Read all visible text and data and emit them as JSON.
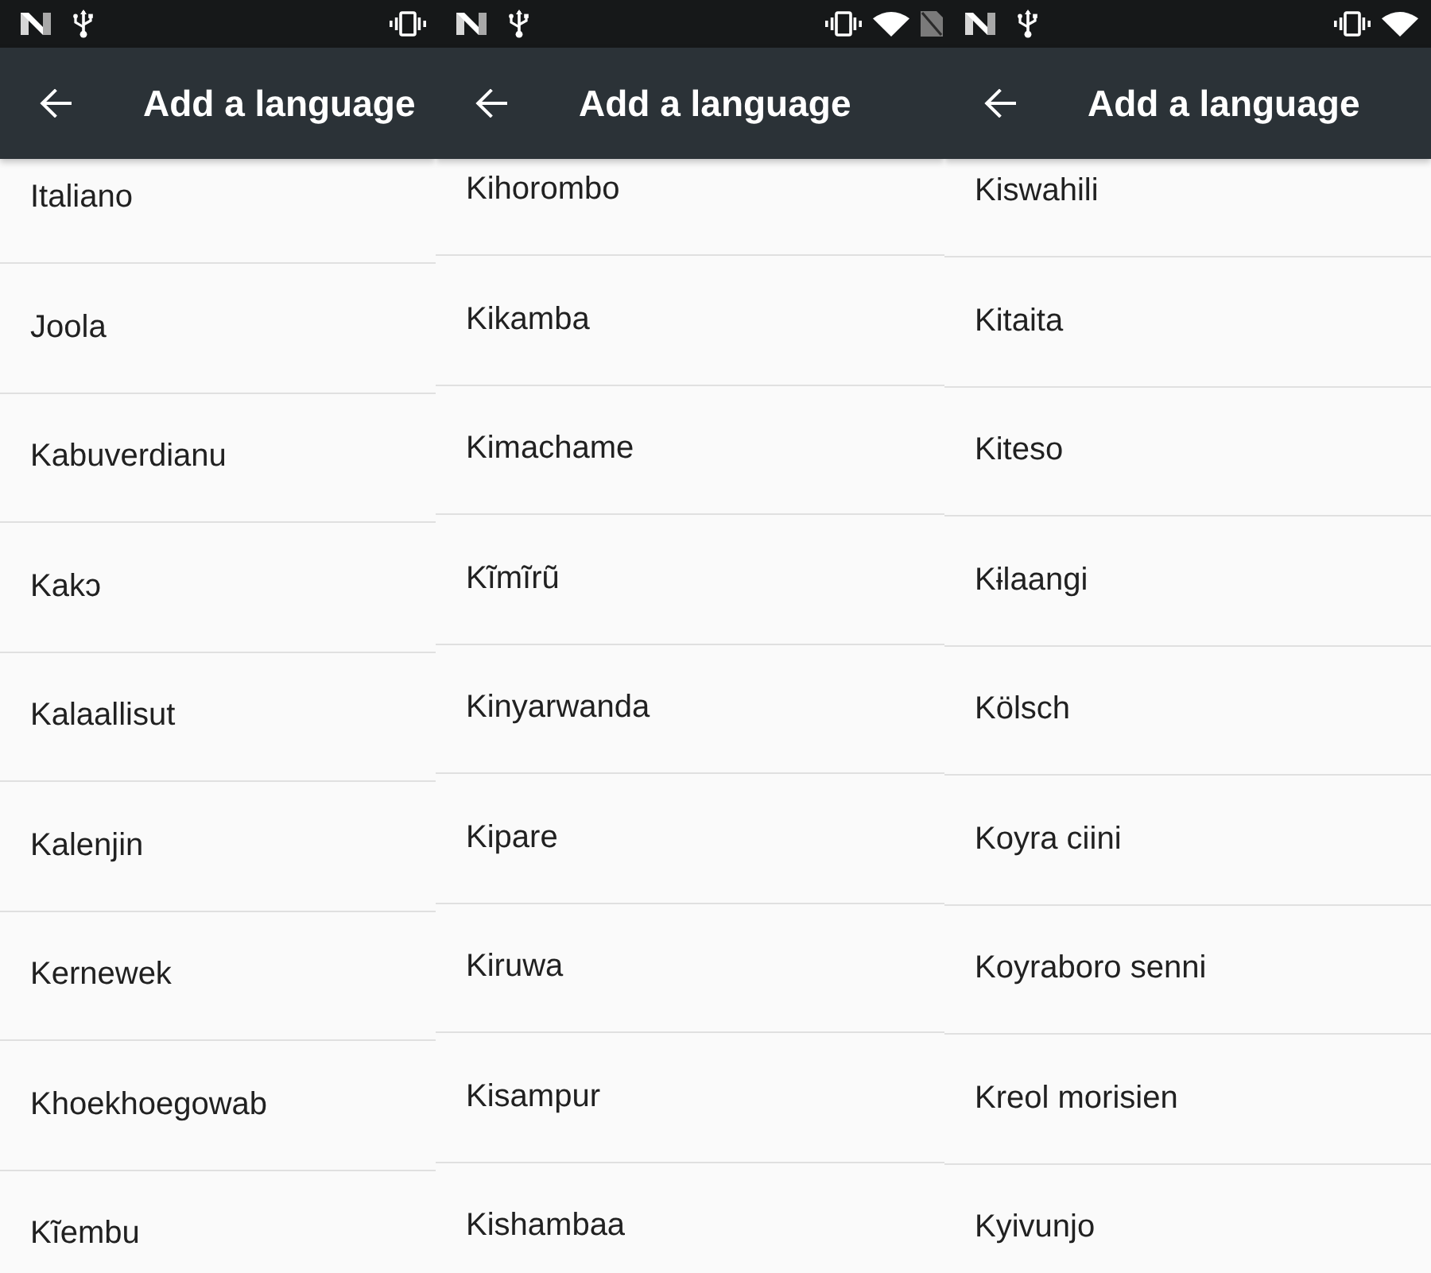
{
  "screens": [
    {
      "toolbar": {
        "title": "Add a language"
      },
      "languages": [
        "Italiano",
        "Joola",
        "Kabuverdianu",
        "Kakɔ",
        "Kalaallisut",
        "Kalenjin",
        "Kernewek",
        "Khoekhoegowab",
        "Kĩembu"
      ]
    },
    {
      "toolbar": {
        "title": "Add a language"
      },
      "languages": [
        "Kihorombo",
        "Kikamba",
        "Kimachame",
        "Kĩmĩrũ",
        "Kinyarwanda",
        "Kipare",
        "Kiruwa",
        "Kisampur",
        "Kishambaa"
      ]
    },
    {
      "toolbar": {
        "title": "Add a language"
      },
      "languages": [
        "Kiswahili",
        "Kitaita",
        "Kiteso",
        "Kɨlaangi",
        "Kölsch",
        "Koyra ciini",
        "Koyraboro senni",
        "Kreol morisien",
        "Kyivunjo"
      ]
    }
  ]
}
